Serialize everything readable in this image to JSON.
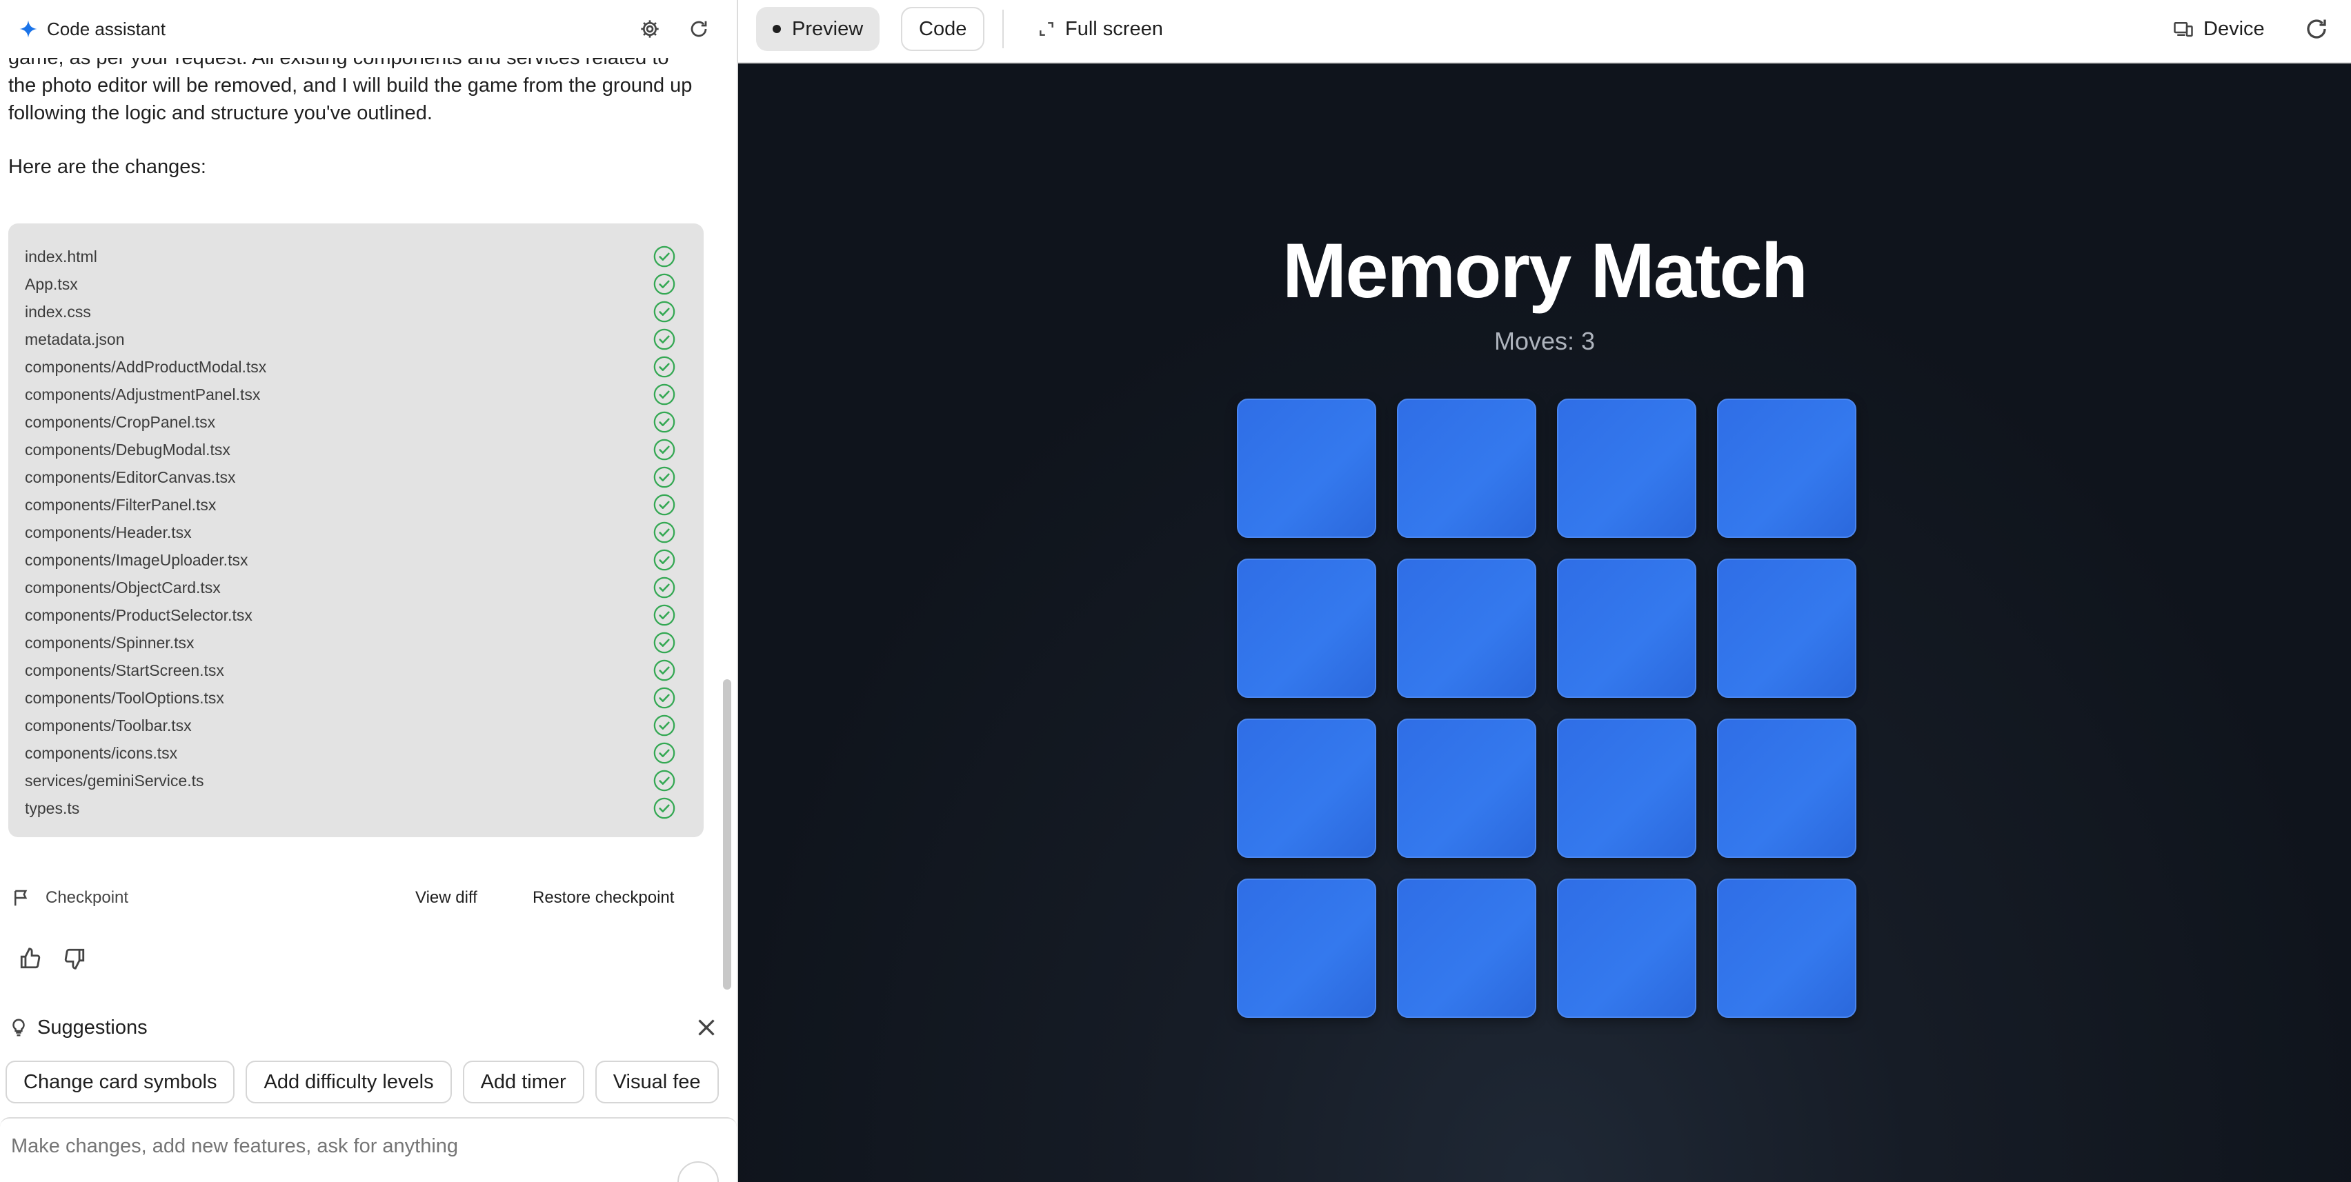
{
  "assistant": {
    "title": "Code assistant",
    "message_line1": "game, as per your request. All existing components and services related to the photo editor will be removed, and I will build the game from the ground up following the logic and structure you've outlined.",
    "message_line2": "Here are the changes:"
  },
  "files": [
    "index.html",
    "App.tsx",
    "index.css",
    "metadata.json",
    "components/AddProductModal.tsx",
    "components/AdjustmentPanel.tsx",
    "components/CropPanel.tsx",
    "components/DebugModal.tsx",
    "components/EditorCanvas.tsx",
    "components/FilterPanel.tsx",
    "components/Header.tsx",
    "components/ImageUploader.tsx",
    "components/ObjectCard.tsx",
    "components/ProductSelector.tsx",
    "components/Spinner.tsx",
    "components/StartScreen.tsx",
    "components/ToolOptions.tsx",
    "components/Toolbar.tsx",
    "components/icons.tsx",
    "services/geminiService.ts",
    "types.ts"
  ],
  "checkpoint": {
    "label": "Checkpoint",
    "view_diff": "View diff",
    "restore": "Restore checkpoint"
  },
  "suggestions": {
    "title": "Suggestions",
    "chips": [
      "Change card symbols",
      "Add difficulty levels",
      "Add timer",
      "Visual fee"
    ]
  },
  "input": {
    "placeholder": "Make changes, add new features, ask for anything"
  },
  "toolbar": {
    "preview": "Preview",
    "code": "Code",
    "full_screen": "Full screen",
    "device": "Device"
  },
  "game": {
    "title": "Memory Match",
    "moves_label": "Moves:",
    "moves": "3",
    "card_count": 16
  },
  "colors": {
    "accent": "#1a73e8",
    "check_green": "#34a853",
    "card_blue": "#3074ea",
    "stage_bg": "#121821"
  }
}
